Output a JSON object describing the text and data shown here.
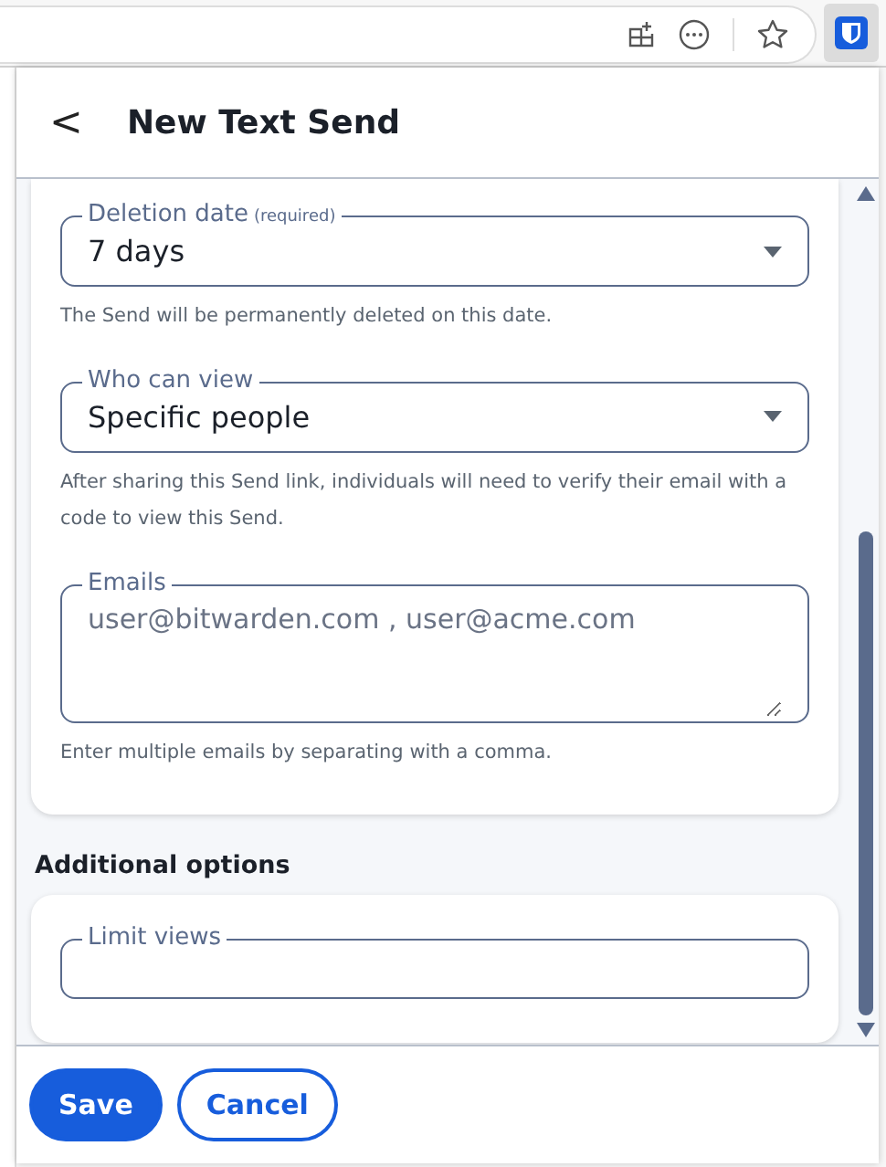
{
  "header": {
    "back": "<",
    "title": "New Text Send"
  },
  "fields": [
    {
      "kind": "select",
      "label": "Deletion date",
      "note": "(required)",
      "value": "7 days",
      "hint": "The Send will be permanently deleted on this date."
    },
    {
      "kind": "select",
      "label": "Who can view",
      "value": "Specific people",
      "hint": "After sharing this Send link, individuals will need to verify their email with a code to view this Send."
    },
    {
      "kind": "textarea",
      "label": "Emails",
      "placeholder": "user@bitwarden.com , user@acme.com",
      "hint": "Enter multiple emails by separating with a comma."
    }
  ],
  "section": {
    "title": "Additional options"
  },
  "options": [
    {
      "kind": "input",
      "label": "Limit views"
    }
  ],
  "footer": {
    "buttons": [
      {
        "label": "Save",
        "kind": "primary"
      },
      {
        "label": "Cancel",
        "kind": "secondary"
      }
    ]
  }
}
